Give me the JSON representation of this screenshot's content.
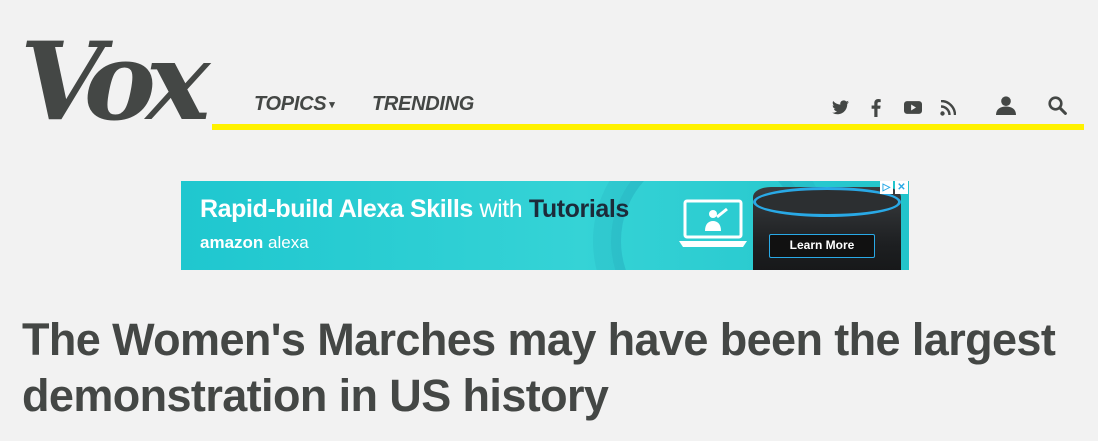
{
  "header": {
    "logo_text": "Vox",
    "nav": {
      "topics_label": "TOPICS",
      "topics_caret": "▾",
      "trending_label": "TRENDING"
    },
    "icons": [
      "twitter-icon",
      "facebook-icon",
      "youtube-icon",
      "rss-icon",
      "user-icon",
      "search-icon"
    ],
    "accent_color": "#fff200"
  },
  "ad": {
    "headline_bold": "Rapid-build Alexa Skills",
    "headline_mid": " with ",
    "headline_end": "Tutorials",
    "brand_light": "amazon",
    "brand_bold": "alexa",
    "cta": "Learn More",
    "adchoices_label": "▷",
    "close_label": "✕"
  },
  "article": {
    "title": "The Women's Marches may have been the largest demonstration in US history"
  }
}
